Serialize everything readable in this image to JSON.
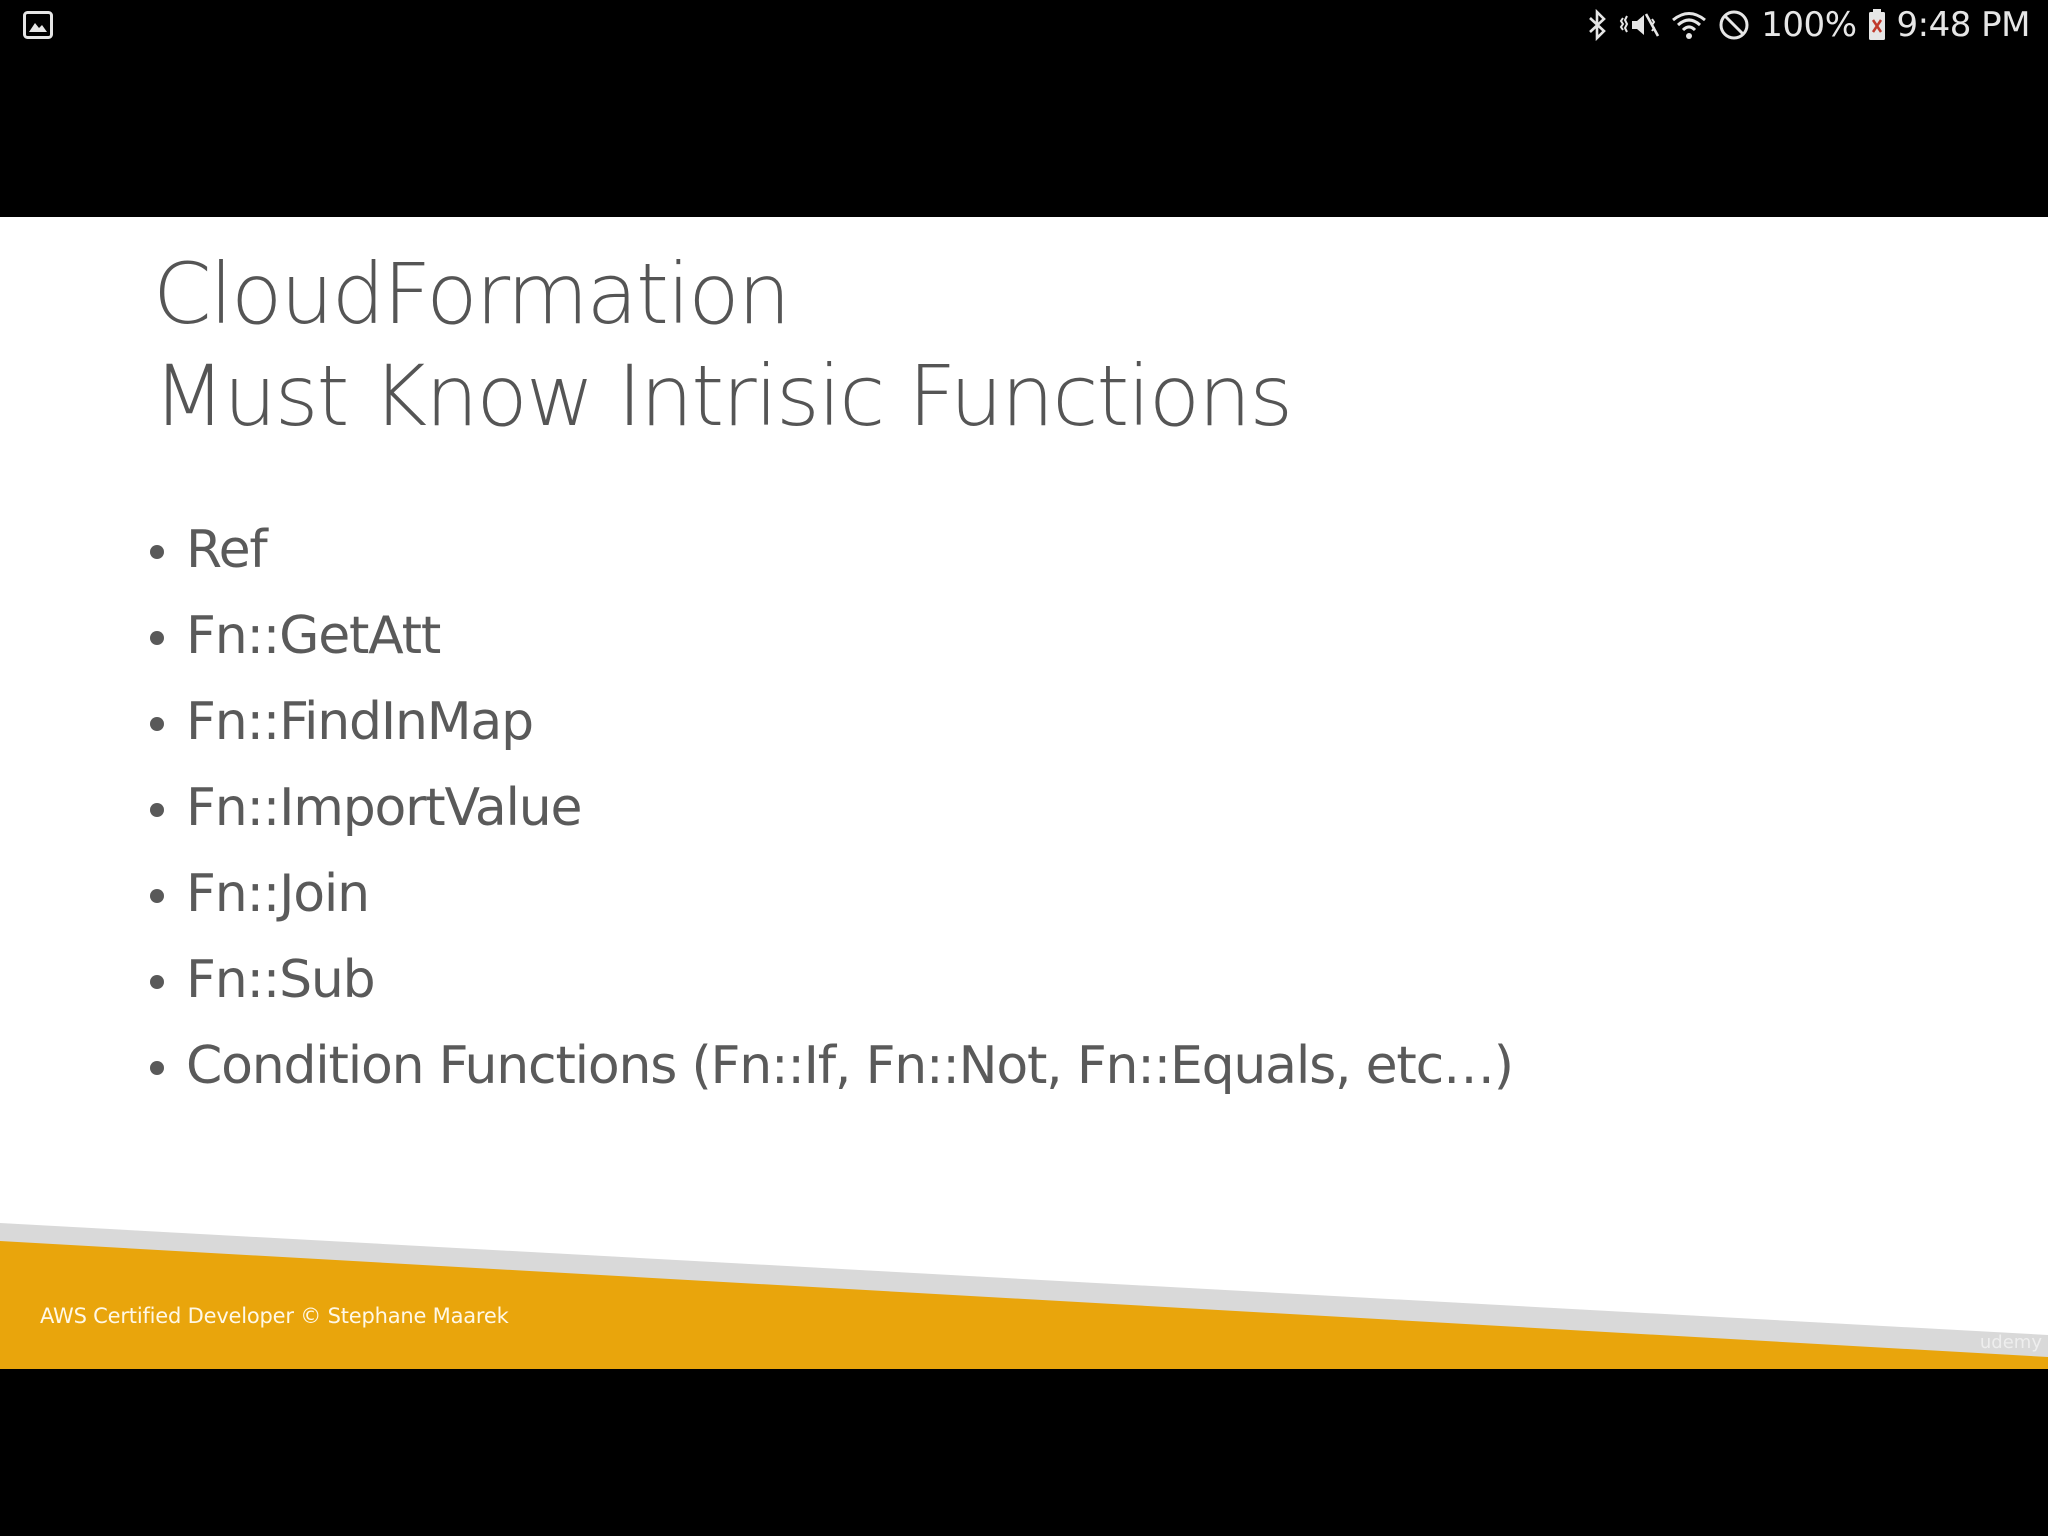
{
  "status_bar": {
    "battery": "100%",
    "time": "9:48 PM",
    "icons": [
      "gallery-icon",
      "bluetooth-icon",
      "vibrate-mute-icon",
      "wifi-icon",
      "do-not-disturb-icon",
      "battery-icon"
    ]
  },
  "slide": {
    "title_line1": "CloudFormation",
    "title_line2": "Must Know Intrisic Functions",
    "bullets": [
      "Ref",
      "Fn::GetAtt",
      "Fn::FindInMap",
      "Fn::ImportValue",
      "Fn::Join",
      "Fn::Sub",
      "Condition Functions (Fn::If, Fn::Not, Fn::Equals, etc…)"
    ],
    "footer": "AWS Certified Developer © Stephane Maarek",
    "brand_mark": "udemy"
  },
  "colors": {
    "background": "#000000",
    "slide": "#ffffff",
    "title_text": "#555555",
    "accent": "#e9a50c",
    "footer_band": "#d9d9d9"
  }
}
